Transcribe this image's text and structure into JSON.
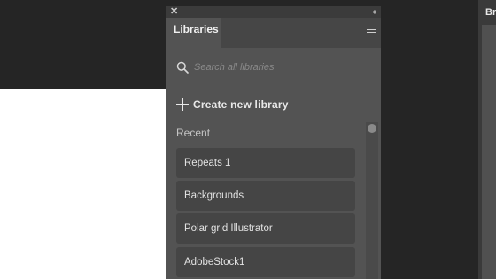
{
  "panel": {
    "close_glyph": "✕",
    "collapse_glyph": "‹‹",
    "tab_label": "Libraries",
    "menu_icon": "hamburger-menu-icon"
  },
  "search": {
    "placeholder": "Search all libraries",
    "value": ""
  },
  "create": {
    "label": "Create new library"
  },
  "recent": {
    "heading": "Recent",
    "items": [
      {
        "label": "Repeats 1"
      },
      {
        "label": "Backgrounds"
      },
      {
        "label": "Polar grid Illustrator"
      },
      {
        "label": "AdobeStock1"
      }
    ]
  },
  "right_panel": {
    "title": "Br"
  },
  "colors": {
    "app_background": "#252525",
    "panel_background": "#535353",
    "item_background": "#454545"
  }
}
